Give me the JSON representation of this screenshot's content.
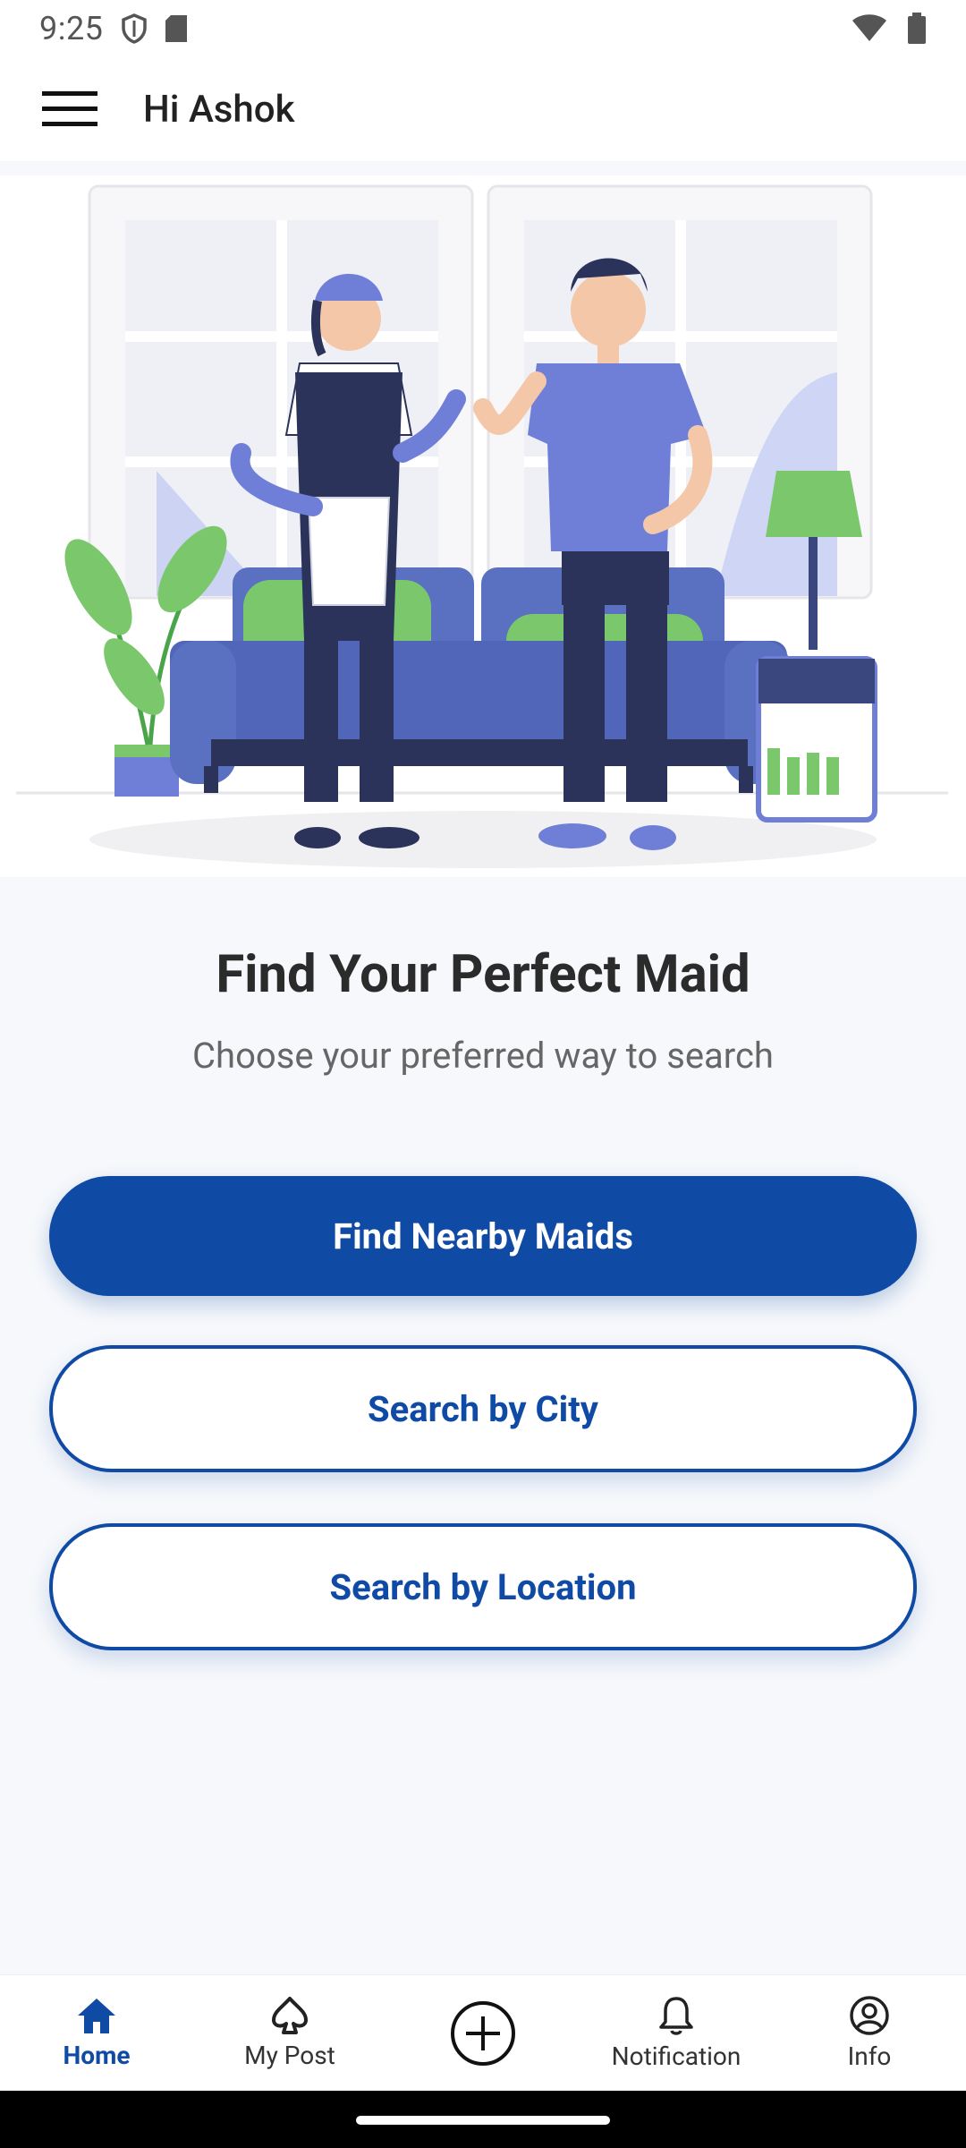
{
  "status_bar": {
    "time": "9:25"
  },
  "app_bar": {
    "greeting": "Hi Ashok"
  },
  "hero": {
    "image": "maid-and-client-illustration"
  },
  "main": {
    "title": "Find Your Perfect Maid",
    "subtitle": "Choose your preferred way to search",
    "primary_button": "Find Nearby Maids",
    "city_button": "Search by City",
    "location_button": "Search by Location"
  },
  "bottom_nav": {
    "items": [
      {
        "label": "Home",
        "icon": "home-icon",
        "active": true
      },
      {
        "label": "My Post",
        "icon": "spade-icon",
        "active": false
      },
      {
        "label": "",
        "icon": "add-circle-icon",
        "active": false
      },
      {
        "label": "Notification",
        "icon": "bell-icon",
        "active": false
      },
      {
        "label": "Info",
        "icon": "account-circle-icon",
        "active": false
      }
    ]
  },
  "colors": {
    "primary": "#0f4aa5",
    "background": "#f6f8fb"
  }
}
